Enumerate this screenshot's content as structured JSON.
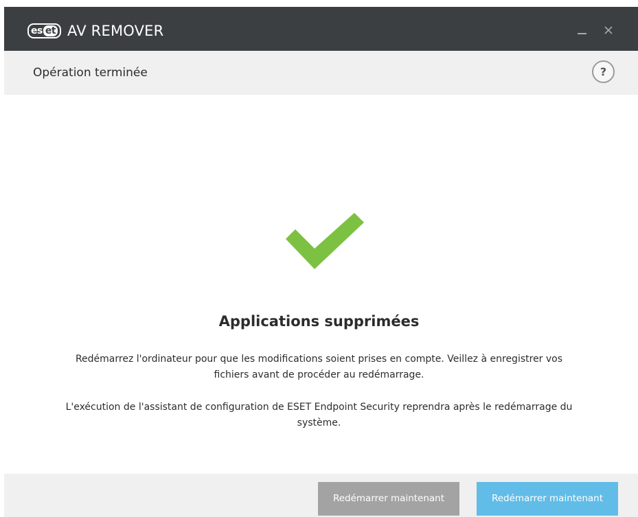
{
  "titlebar": {
    "logo_text_a": "es",
    "logo_text_b": "et",
    "app_name": "AV REMOVER"
  },
  "header": {
    "title": "Opération terminée",
    "help_label": "?"
  },
  "main": {
    "heading": "Applications supprimées",
    "paragraph1_lines": [
      "Redémarrez l'ordinateur pour que les modifications soient prises en compte. Veillez à enregistrer vos",
      "fichiers avant de procéder au redémarrage."
    ],
    "paragraph2_lines": [
      "L'exécution de l'assistant de configuration de ESET Endpoint Security reprendra après le redémarrage du",
      "système."
    ]
  },
  "footer": {
    "restart_now_grey_label": "Redémarrer maintenant",
    "restart_now_blue_label": "Redémarrer maintenant"
  },
  "colors": {
    "titlebar_bg": "#3b3f42",
    "check_green": "#7dc142",
    "primary_button": "#62bce8",
    "secondary_button": "#a3a3a3"
  },
  "icons": {
    "minimize": "minimize-icon",
    "close": "close-icon",
    "help": "help-icon",
    "success": "checkmark-icon"
  }
}
